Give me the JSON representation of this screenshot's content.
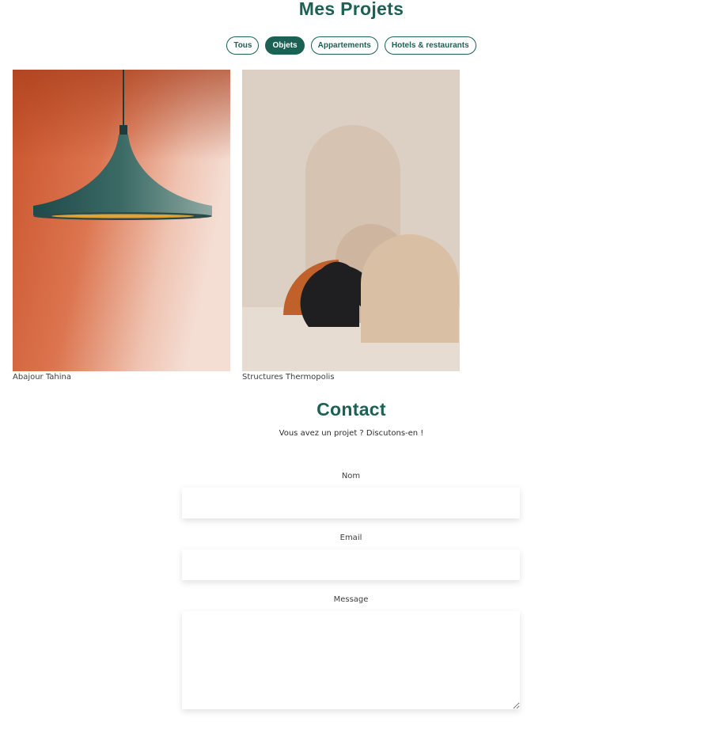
{
  "projects": {
    "title": "Mes Projets",
    "filters": [
      {
        "label": "Tous",
        "active": false
      },
      {
        "label": "Objets",
        "active": true
      },
      {
        "label": "Appartements",
        "active": false
      },
      {
        "label": "Hotels & restaurants",
        "active": false
      }
    ],
    "items": [
      {
        "caption": "Abajour Tahina"
      },
      {
        "caption": "Structures Thermopolis"
      }
    ]
  },
  "contact": {
    "title": "Contact",
    "subtitle": "Vous avez un projet ? Discutons-en !",
    "fields": {
      "name_label": "Nom",
      "email_label": "Email",
      "message_label": "Message"
    }
  },
  "colors": {
    "accent": "#1d6154"
  }
}
